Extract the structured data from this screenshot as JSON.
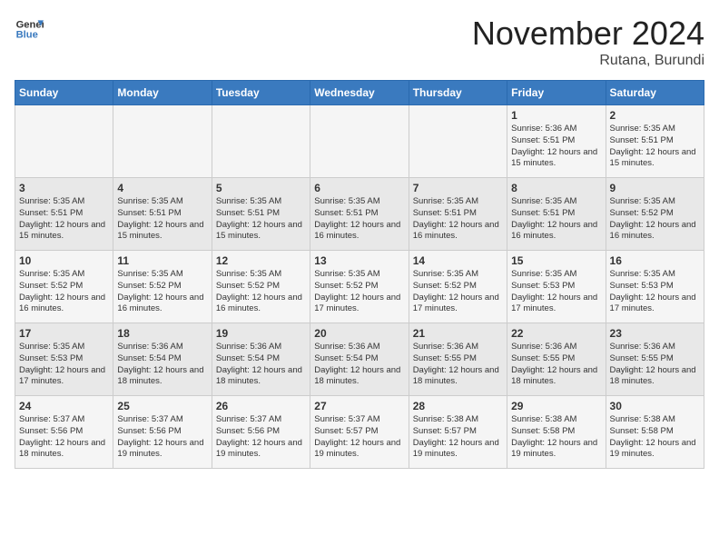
{
  "header": {
    "logo_line1": "General",
    "logo_line2": "Blue",
    "month": "November 2024",
    "location": "Rutana, Burundi"
  },
  "weekdays": [
    "Sunday",
    "Monday",
    "Tuesday",
    "Wednesday",
    "Thursday",
    "Friday",
    "Saturday"
  ],
  "weeks": [
    [
      {
        "day": "",
        "info": ""
      },
      {
        "day": "",
        "info": ""
      },
      {
        "day": "",
        "info": ""
      },
      {
        "day": "",
        "info": ""
      },
      {
        "day": "",
        "info": ""
      },
      {
        "day": "1",
        "info": "Sunrise: 5:36 AM\nSunset: 5:51 PM\nDaylight: 12 hours and 15 minutes."
      },
      {
        "day": "2",
        "info": "Sunrise: 5:35 AM\nSunset: 5:51 PM\nDaylight: 12 hours and 15 minutes."
      }
    ],
    [
      {
        "day": "3",
        "info": "Sunrise: 5:35 AM\nSunset: 5:51 PM\nDaylight: 12 hours and 15 minutes."
      },
      {
        "day": "4",
        "info": "Sunrise: 5:35 AM\nSunset: 5:51 PM\nDaylight: 12 hours and 15 minutes."
      },
      {
        "day": "5",
        "info": "Sunrise: 5:35 AM\nSunset: 5:51 PM\nDaylight: 12 hours and 15 minutes."
      },
      {
        "day": "6",
        "info": "Sunrise: 5:35 AM\nSunset: 5:51 PM\nDaylight: 12 hours and 16 minutes."
      },
      {
        "day": "7",
        "info": "Sunrise: 5:35 AM\nSunset: 5:51 PM\nDaylight: 12 hours and 16 minutes."
      },
      {
        "day": "8",
        "info": "Sunrise: 5:35 AM\nSunset: 5:51 PM\nDaylight: 12 hours and 16 minutes."
      },
      {
        "day": "9",
        "info": "Sunrise: 5:35 AM\nSunset: 5:52 PM\nDaylight: 12 hours and 16 minutes."
      }
    ],
    [
      {
        "day": "10",
        "info": "Sunrise: 5:35 AM\nSunset: 5:52 PM\nDaylight: 12 hours and 16 minutes."
      },
      {
        "day": "11",
        "info": "Sunrise: 5:35 AM\nSunset: 5:52 PM\nDaylight: 12 hours and 16 minutes."
      },
      {
        "day": "12",
        "info": "Sunrise: 5:35 AM\nSunset: 5:52 PM\nDaylight: 12 hours and 16 minutes."
      },
      {
        "day": "13",
        "info": "Sunrise: 5:35 AM\nSunset: 5:52 PM\nDaylight: 12 hours and 17 minutes."
      },
      {
        "day": "14",
        "info": "Sunrise: 5:35 AM\nSunset: 5:52 PM\nDaylight: 12 hours and 17 minutes."
      },
      {
        "day": "15",
        "info": "Sunrise: 5:35 AM\nSunset: 5:53 PM\nDaylight: 12 hours and 17 minutes."
      },
      {
        "day": "16",
        "info": "Sunrise: 5:35 AM\nSunset: 5:53 PM\nDaylight: 12 hours and 17 minutes."
      }
    ],
    [
      {
        "day": "17",
        "info": "Sunrise: 5:35 AM\nSunset: 5:53 PM\nDaylight: 12 hours and 17 minutes."
      },
      {
        "day": "18",
        "info": "Sunrise: 5:36 AM\nSunset: 5:54 PM\nDaylight: 12 hours and 18 minutes."
      },
      {
        "day": "19",
        "info": "Sunrise: 5:36 AM\nSunset: 5:54 PM\nDaylight: 12 hours and 18 minutes."
      },
      {
        "day": "20",
        "info": "Sunrise: 5:36 AM\nSunset: 5:54 PM\nDaylight: 12 hours and 18 minutes."
      },
      {
        "day": "21",
        "info": "Sunrise: 5:36 AM\nSunset: 5:55 PM\nDaylight: 12 hours and 18 minutes."
      },
      {
        "day": "22",
        "info": "Sunrise: 5:36 AM\nSunset: 5:55 PM\nDaylight: 12 hours and 18 minutes."
      },
      {
        "day": "23",
        "info": "Sunrise: 5:36 AM\nSunset: 5:55 PM\nDaylight: 12 hours and 18 minutes."
      }
    ],
    [
      {
        "day": "24",
        "info": "Sunrise: 5:37 AM\nSunset: 5:56 PM\nDaylight: 12 hours and 18 minutes."
      },
      {
        "day": "25",
        "info": "Sunrise: 5:37 AM\nSunset: 5:56 PM\nDaylight: 12 hours and 19 minutes."
      },
      {
        "day": "26",
        "info": "Sunrise: 5:37 AM\nSunset: 5:56 PM\nDaylight: 12 hours and 19 minutes."
      },
      {
        "day": "27",
        "info": "Sunrise: 5:37 AM\nSunset: 5:57 PM\nDaylight: 12 hours and 19 minutes."
      },
      {
        "day": "28",
        "info": "Sunrise: 5:38 AM\nSunset: 5:57 PM\nDaylight: 12 hours and 19 minutes."
      },
      {
        "day": "29",
        "info": "Sunrise: 5:38 AM\nSunset: 5:58 PM\nDaylight: 12 hours and 19 minutes."
      },
      {
        "day": "30",
        "info": "Sunrise: 5:38 AM\nSunset: 5:58 PM\nDaylight: 12 hours and 19 minutes."
      }
    ]
  ]
}
